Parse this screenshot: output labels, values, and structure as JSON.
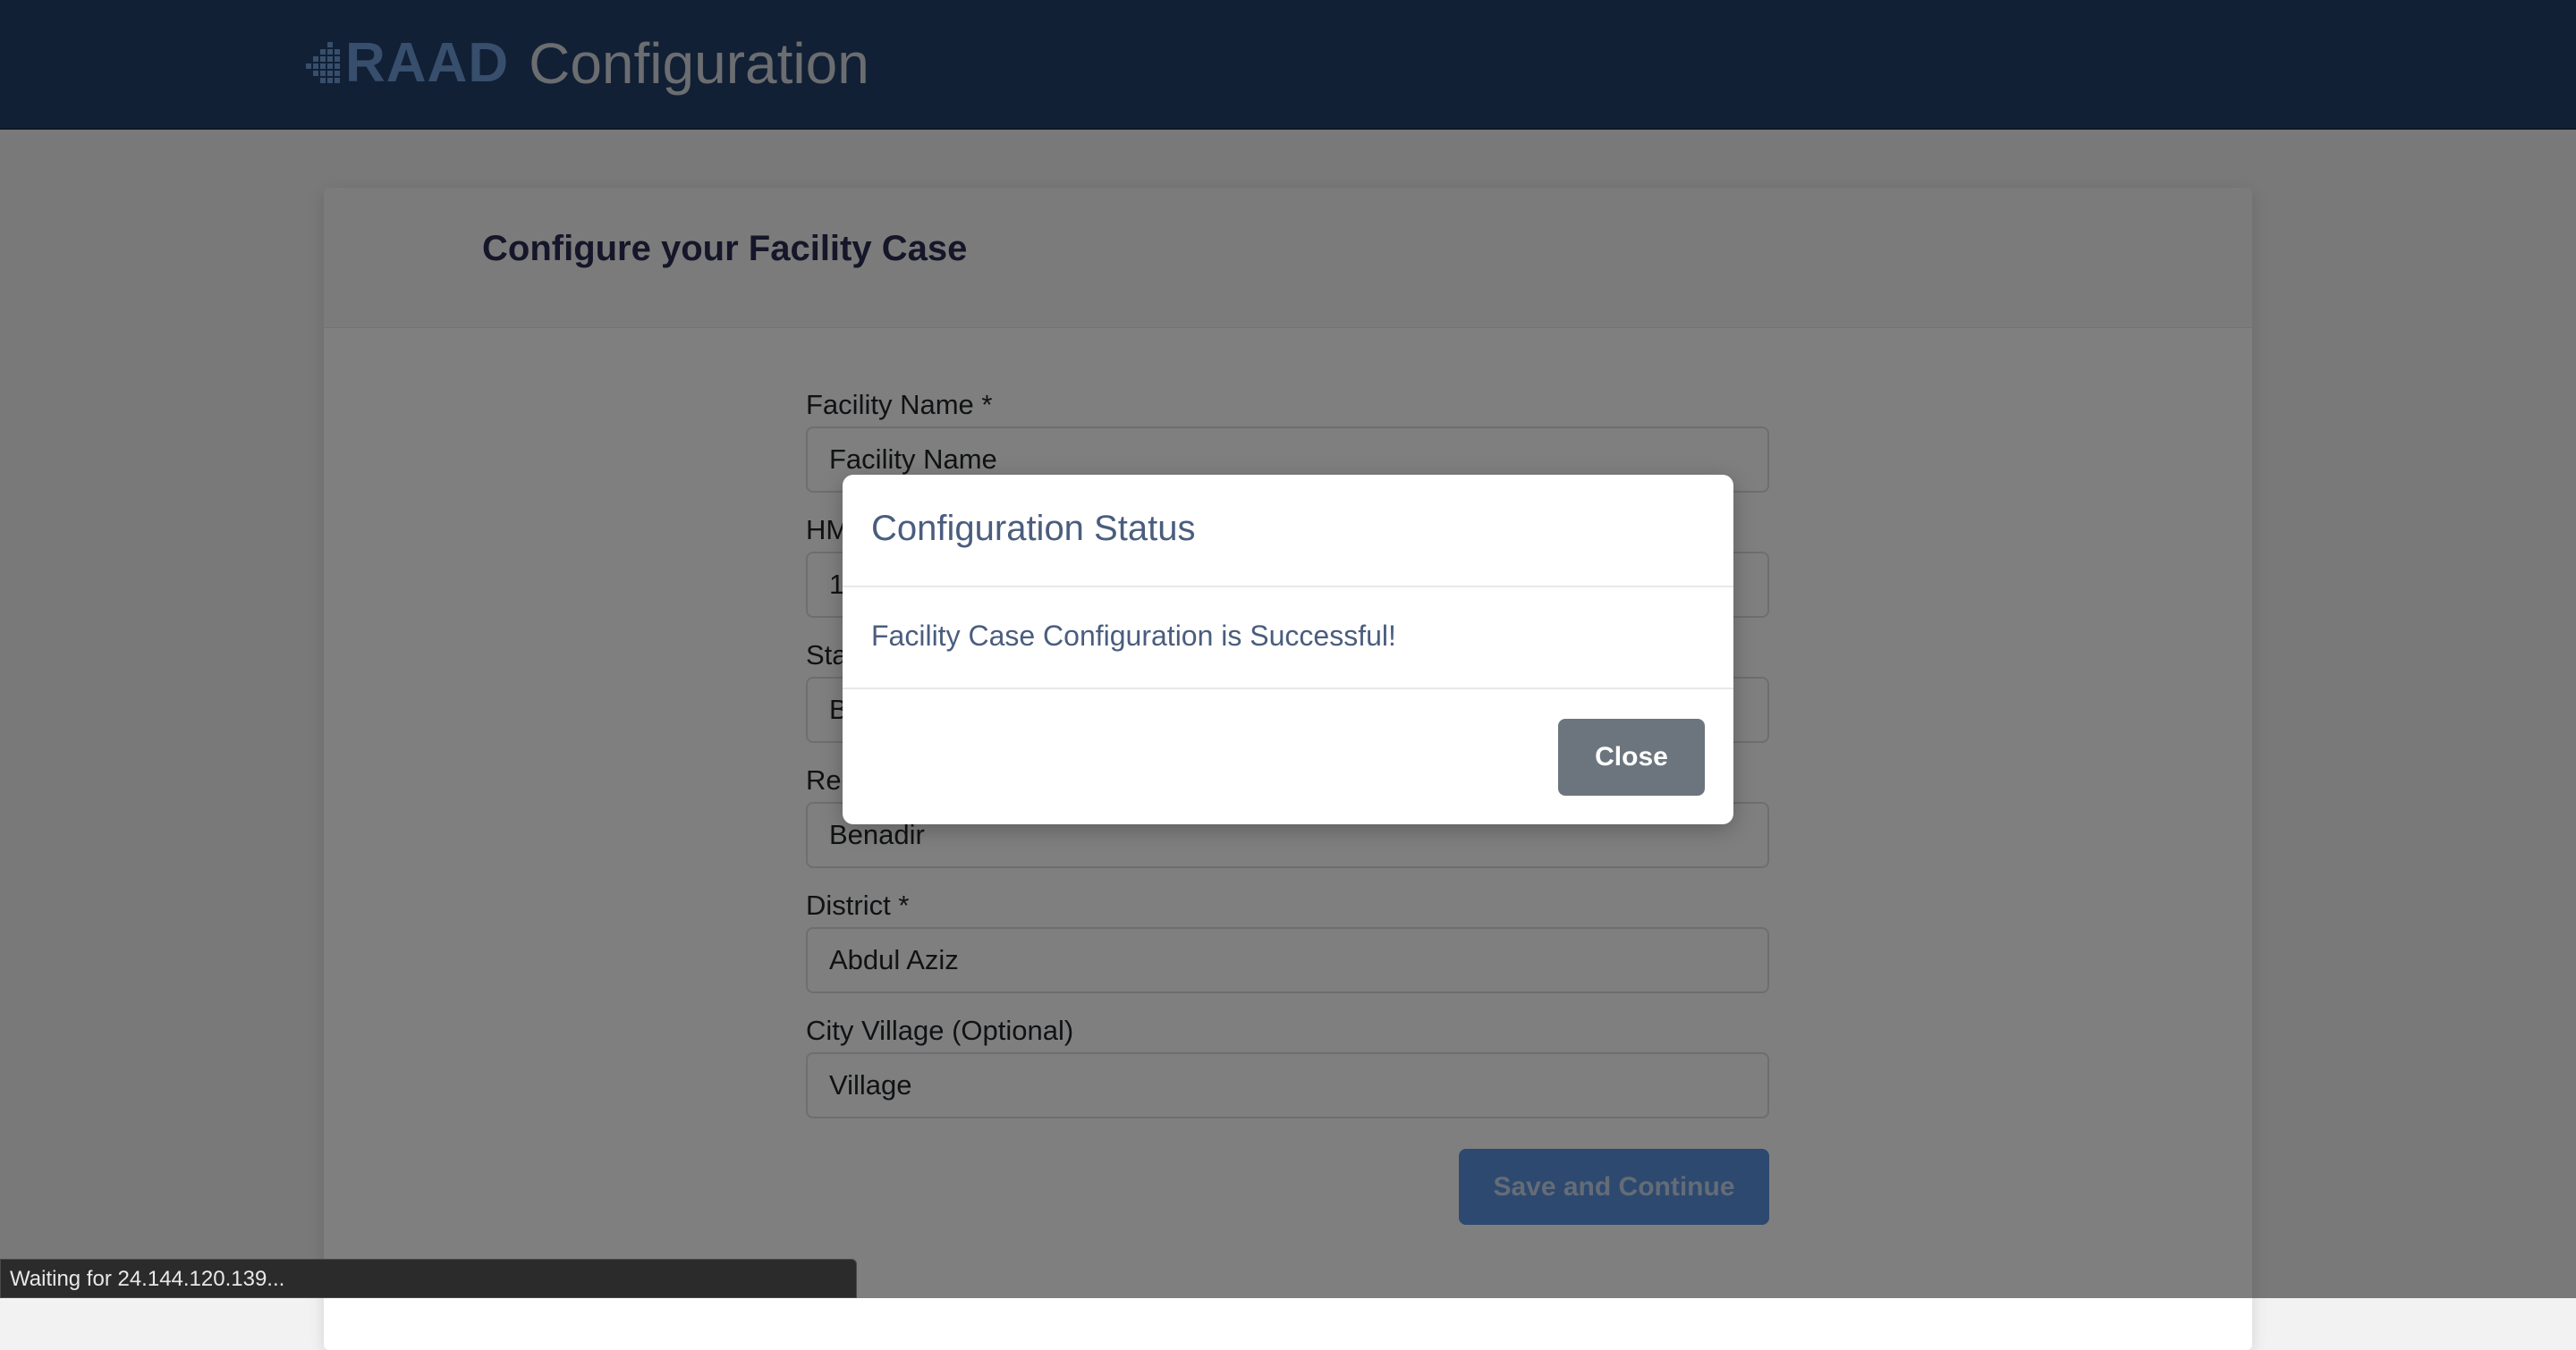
{
  "header": {
    "logo_text": "RAAD",
    "title": "Configuration"
  },
  "form": {
    "title": "Configure your Facility Case",
    "fields": [
      {
        "label": "Facility Name *",
        "value": "",
        "placeholder": "Facility Name"
      },
      {
        "label": "HMIS Code *",
        "value": "1",
        "placeholder": ""
      },
      {
        "label": "State *",
        "value": "B",
        "placeholder": ""
      },
      {
        "label": "Region *",
        "value": "Benadir",
        "placeholder": ""
      },
      {
        "label": "District *",
        "value": "Abdul Aziz",
        "placeholder": ""
      },
      {
        "label": "City Village (Optional)",
        "value": "",
        "placeholder": "Village"
      }
    ],
    "save_label": "Save and Continue"
  },
  "modal": {
    "title": "Configuration Status",
    "message": "Facility Case Configuration is Successful!",
    "close_label": "Close"
  },
  "status_bar": {
    "text": "Waiting for 24.144.120.139..."
  },
  "colors": {
    "header_bg": "#22416a",
    "logo": "#6e9ed8",
    "primary_button": "#5b93df",
    "close_button": "#6c757d",
    "modal_text": "#4a5d7e"
  },
  "icons": {
    "logo_mark": "dotted-arrow-logo-icon"
  }
}
